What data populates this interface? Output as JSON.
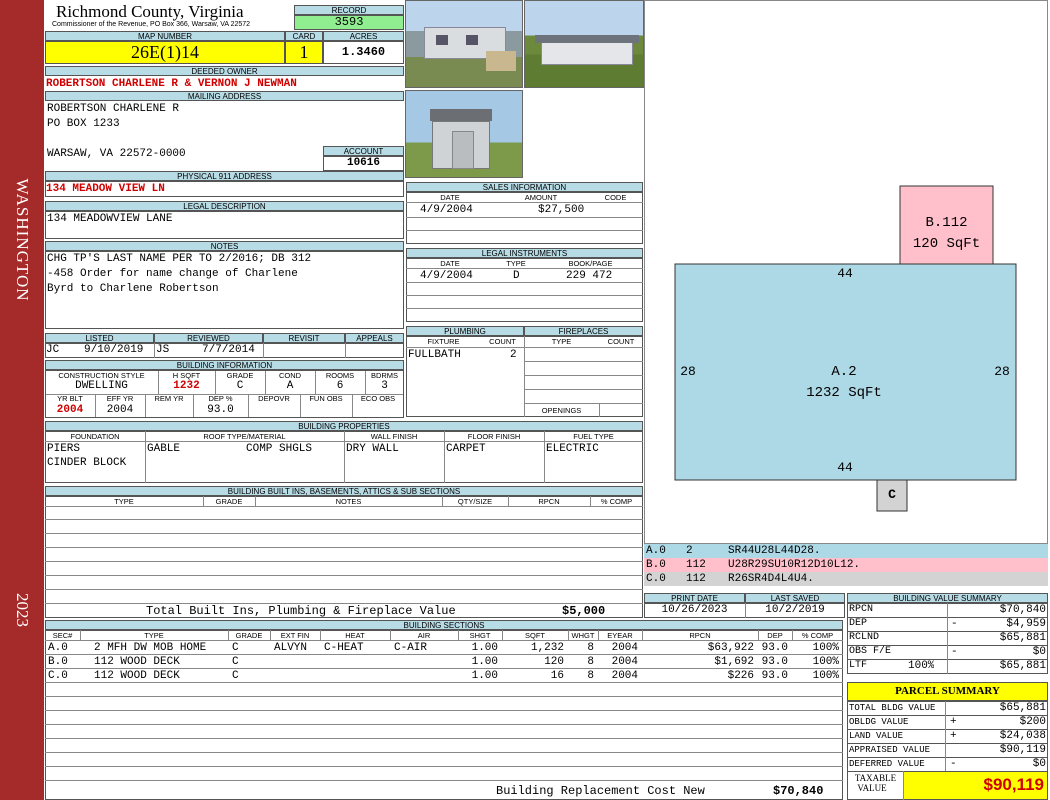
{
  "sidebar": {
    "county": "WASHINGTON",
    "year": "2023"
  },
  "header": {
    "title": "Richmond County, Virginia",
    "subtitle": "Commissioner of the Revenue, PO Box 366, Warsaw, VA 22572",
    "record_label": "RECORD",
    "record": "3593",
    "map_label": "MAP NUMBER",
    "map_number": "26E(1)14",
    "card_label": "CARD",
    "card": "1",
    "acres_label": "ACRES",
    "acres": "1.3460"
  },
  "owner": {
    "deeded_label": "DEEDED OWNER",
    "deeded": "ROBERTSON CHARLENE R & VERNON J NEWMAN",
    "mailing_label": "MAILING ADDRESS",
    "mail_line1": "ROBERTSON CHARLENE R",
    "mail_line2": "PO BOX 1233",
    "mail_line3": "WARSAW, VA 22572-0000",
    "account_label": "ACCOUNT",
    "account": "10616",
    "physical_label": "PHYSICAL 911 ADDRESS",
    "physical": "134 MEADOW VIEW LN",
    "legal_label": "LEGAL DESCRIPTION",
    "legal": "134 MEADOWVIEW LANE",
    "notes_label": "NOTES",
    "notes_line1": "CHG TP'S LAST NAME PER TO 2/2016; DB 312",
    "notes_line2": "-458 Order for name change of Charlene",
    "notes_line3": "Byrd to Charlene Robertson"
  },
  "review": {
    "listed_label": "LISTED",
    "reviewed_label": "REVIEWED",
    "revisit_label": "REVISIT",
    "appeals_label": "APPEALS",
    "listed_by": "JC",
    "listed_date": "9/10/2019",
    "reviewed_by": "JS",
    "reviewed_date": "7/7/2014"
  },
  "building_info": {
    "section_label": "BUILDING INFORMATION",
    "labels": [
      "CONSTRUCTION STYLE",
      "H SQFT",
      "GRADE",
      "COND",
      "ROOMS",
      "BDRMS"
    ],
    "values": [
      "DWELLING",
      "1232",
      "C",
      "A",
      "6",
      "3"
    ],
    "labels2": [
      "YR BLT",
      "EFF YR",
      "REM YR",
      "DEP %",
      "DEPOVR",
      "FUN OBS",
      "ECO OBS"
    ],
    "values2": [
      "2004",
      "2004",
      "",
      "93.0",
      "",
      "",
      ""
    ]
  },
  "sales": {
    "section_label": "SALES INFORMATION",
    "cols": [
      "DATE",
      "AMOUNT",
      "CODE"
    ],
    "rows": [
      [
        "4/9/2004",
        "$27,500",
        ""
      ]
    ]
  },
  "legal_instruments": {
    "section_label": "LEGAL INSTRUMENTS",
    "cols": [
      "DATE",
      "TYPE",
      "BOOK/PAGE"
    ],
    "rows": [
      [
        "4/9/2004",
        "D",
        "229 472"
      ]
    ]
  },
  "plumbing": {
    "section_label": "PLUMBING",
    "cols": [
      "FIXTURE",
      "COUNT"
    ],
    "rows": [
      [
        "FULLBATH",
        "2"
      ]
    ]
  },
  "fireplaces": {
    "section_label": "FIREPLACES",
    "cols": [
      "TYPE",
      "COUNT"
    ],
    "openings_label": "OPENINGS"
  },
  "properties": {
    "section_label": "BUILDING PROPERTIES",
    "cols": [
      "FOUNDATION",
      "ROOF TYPE/MATERIAL",
      "WALL FINISH",
      "FLOOR FINISH",
      "FUEL TYPE"
    ],
    "foundation1": "PIERS",
    "foundation2": "CINDER BLOCK",
    "roof_type": "GABLE",
    "roof_material": "COMP SHGLS",
    "wall": "DRY WALL",
    "floor": "CARPET",
    "fuel": "ELECTRIC"
  },
  "builtins": {
    "section_label": "BUILDING BUILT INS, BASEMENTS, ATTICS & SUB SECTIONS",
    "cols": [
      "TYPE",
      "GRADE",
      "NOTES",
      "QTY/SIZE",
      "RPCN",
      "% COMP"
    ],
    "total_label": "Total Built Ins, Plumbing & Fireplace Value",
    "total": "$5,000"
  },
  "dates": {
    "print_label": "PRINT DATE",
    "print": "10/26/2023",
    "saved_label": "LAST SAVED",
    "saved": "10/2/2019"
  },
  "sketch": {
    "main": {
      "id": "A.2",
      "area": "1232 SqFt",
      "top": "44",
      "bottom": "44",
      "left": "28",
      "right": "28"
    },
    "deck": {
      "id": "B.112",
      "area": "120 SqFt"
    },
    "small": {
      "id": "C"
    },
    "legend": [
      {
        "code": "A.0",
        "num": "2",
        "path": "SR44U28L44D28.",
        "color": "#add8e6"
      },
      {
        "code": "B.0",
        "num": "112",
        "path": "U28R29SU10R12D10L12.",
        "color": "#ffc0cb"
      },
      {
        "code": "C.0",
        "num": "112",
        "path": "R26SR4D4L4U4.",
        "color": "#d3d3d3"
      }
    ]
  },
  "value_summary": {
    "section_label": "BUILDING VALUE SUMMARY",
    "rows": [
      {
        "label": "RPCN",
        "sign": "",
        "value": "$70,840"
      },
      {
        "label": "DEP",
        "sign": "-",
        "value": "$4,959"
      },
      {
        "label": "RCLND",
        "sign": "",
        "value": "$65,881"
      },
      {
        "label": "OBS F/E",
        "sign": "-",
        "value": "$0"
      },
      {
        "label": "LTF",
        "sign": "100%",
        "value": "$65,881"
      }
    ]
  },
  "parcel_summary": {
    "section_label": "PARCEL SUMMARY",
    "rows": [
      {
        "label": "TOTAL BLDG VALUE",
        "sign": "",
        "value": "$65,881"
      },
      {
        "label": "OBLDG VALUE",
        "sign": "+",
        "value": "$200"
      },
      {
        "label": "LAND VALUE",
        "sign": "+",
        "value": "$24,038"
      },
      {
        "label": "APPRAISED VALUE",
        "sign": "",
        "value": "$90,119"
      },
      {
        "label": "DEFERRED VALUE",
        "sign": "-",
        "value": "$0"
      }
    ],
    "taxable_label1": "TAXABLE",
    "taxable_label2": "VALUE",
    "taxable": "$90,119"
  },
  "sections": {
    "section_label": "BUILDING SECTIONS",
    "cols": [
      "SEC#",
      "TYPE",
      "GRADE",
      "EXT FIN",
      "HEAT",
      "AIR",
      "SHGT",
      "SQFT",
      "WHGT",
      "EYEAR",
      "RPCN",
      "DEP",
      "% COMP"
    ],
    "rows": [
      [
        "A.0",
        "2 MFH DW MOB HOME",
        "C",
        "ALVYN",
        "C-HEAT",
        "C-AIR",
        "1.00",
        "1,232",
        "8",
        "2004",
        "$63,922",
        "93.0",
        "100%"
      ],
      [
        "B.0",
        "112 WOOD DECK",
        "C",
        "",
        "",
        "",
        "1.00",
        "120",
        "8",
        "2004",
        "$1,692",
        "93.0",
        "100%"
      ],
      [
        "C.0",
        "112 WOOD DECK",
        "C",
        "",
        "",
        "",
        "1.00",
        "16",
        "8",
        "2004",
        "$226",
        "93.0",
        "100%"
      ]
    ],
    "replacement_label": "Building Replacement Cost New",
    "replacement": "$70,840"
  }
}
